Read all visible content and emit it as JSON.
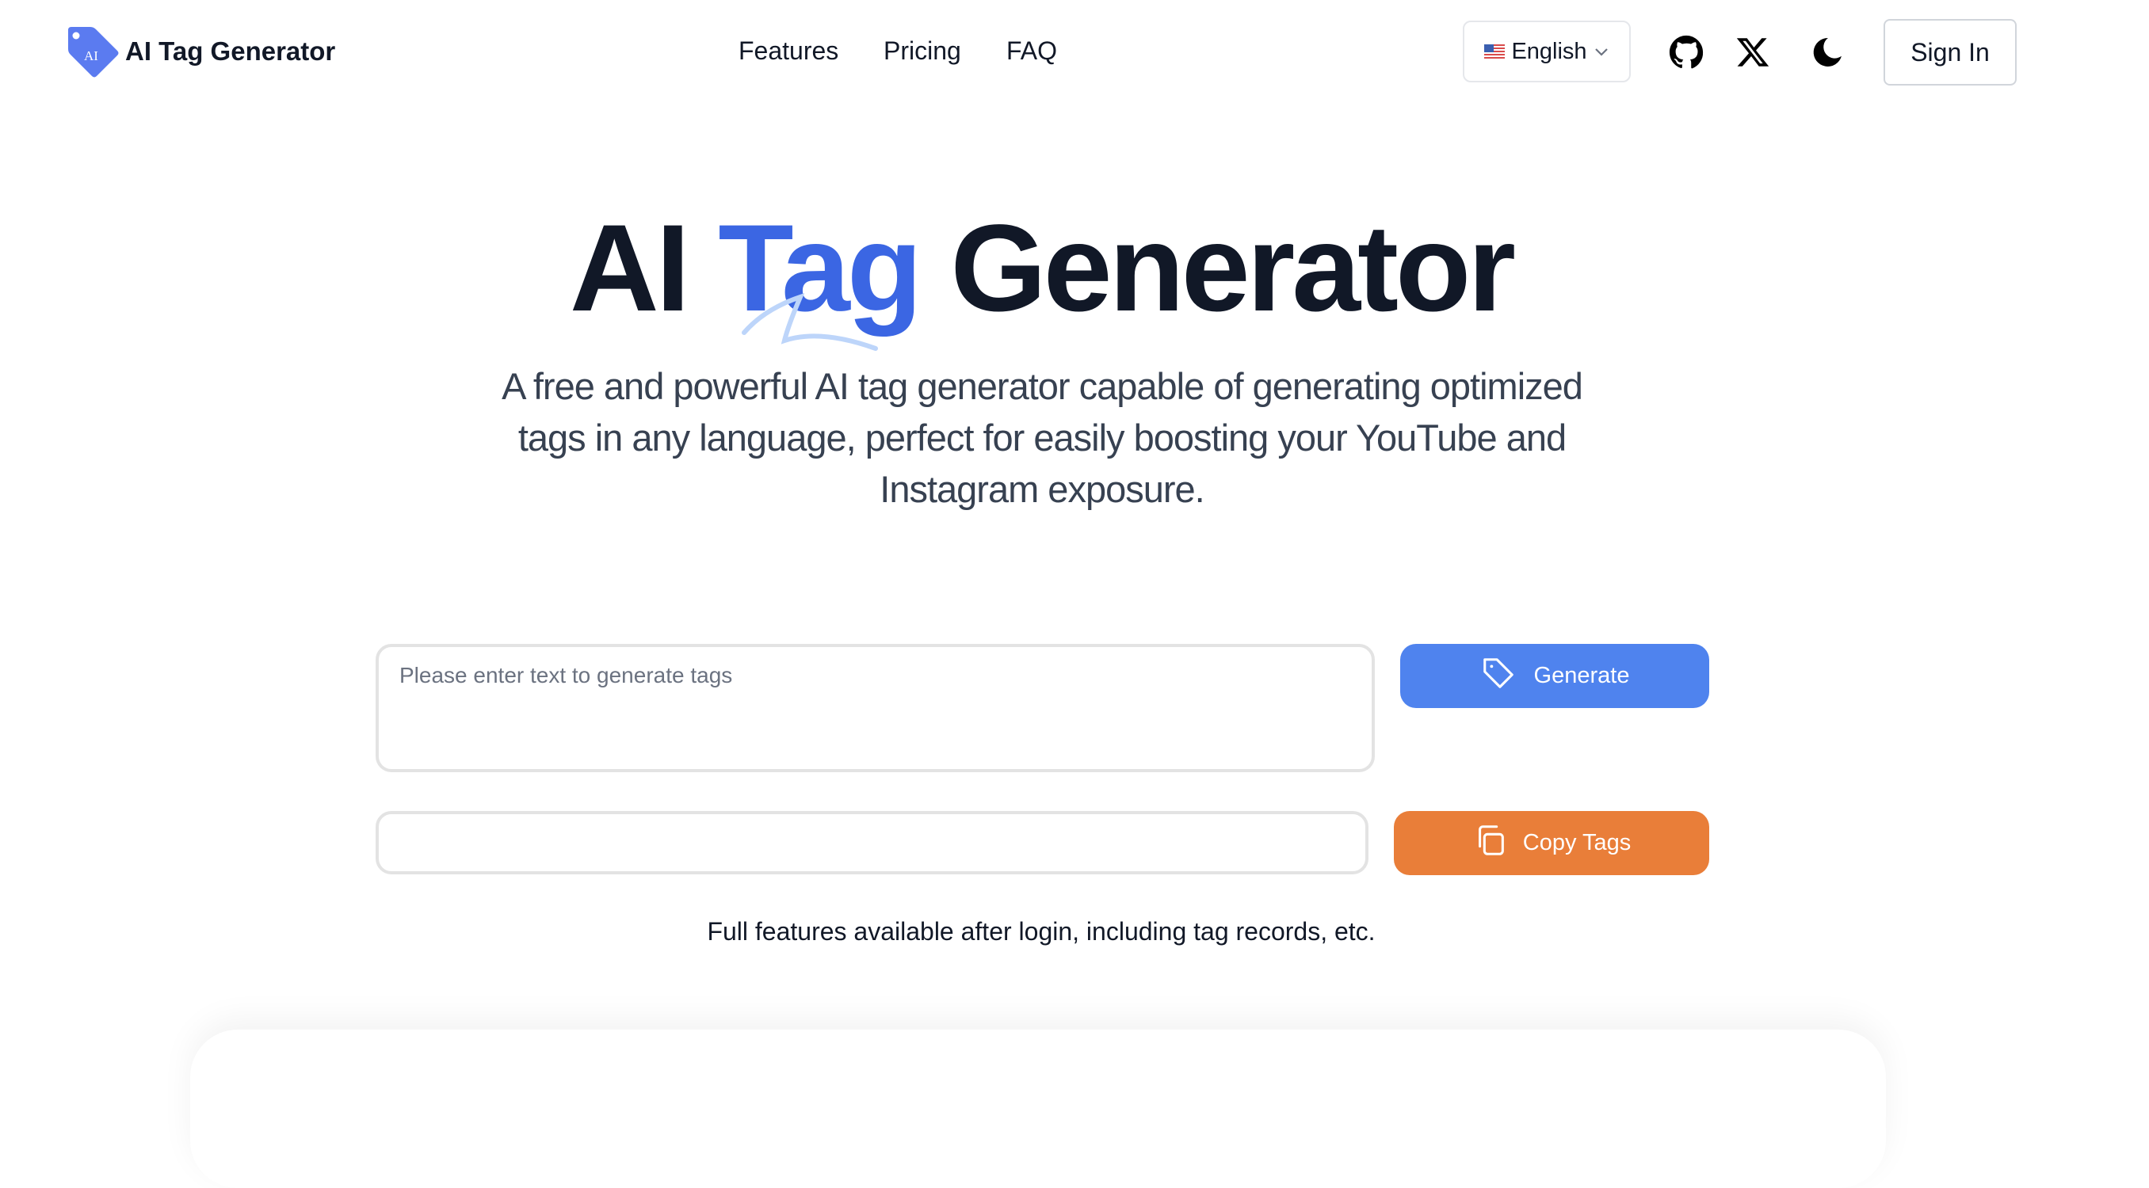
{
  "header": {
    "logo_badge": "AI",
    "brand": "AI Tag Generator",
    "nav": [
      {
        "label": "Features"
      },
      {
        "label": "Pricing"
      },
      {
        "label": "FAQ"
      }
    ],
    "language": {
      "selected": "English",
      "flag": "us-flag-icon"
    },
    "icons": [
      "github-icon",
      "x-twitter-icon",
      "moon-icon"
    ],
    "sign_in": "Sign In"
  },
  "hero": {
    "title_prefix": "AI ",
    "title_accent": "Tag",
    "title_suffix": " Generator",
    "subtitle": "A free and powerful AI tag generator capable of generating optimized tags in any language, perfect for easily boosting your YouTube and Instagram exposure."
  },
  "form": {
    "input_placeholder": "Please enter text to generate tags",
    "input_value": "",
    "generate_label": "Generate",
    "output_value": "",
    "copy_label": "Copy Tags",
    "footnote": "Full features available after login, including tag records, etc."
  },
  "colors": {
    "accent": "#3b66e3",
    "generate": "#4f83ee",
    "copy": "#e97e39",
    "text": "#111827"
  }
}
